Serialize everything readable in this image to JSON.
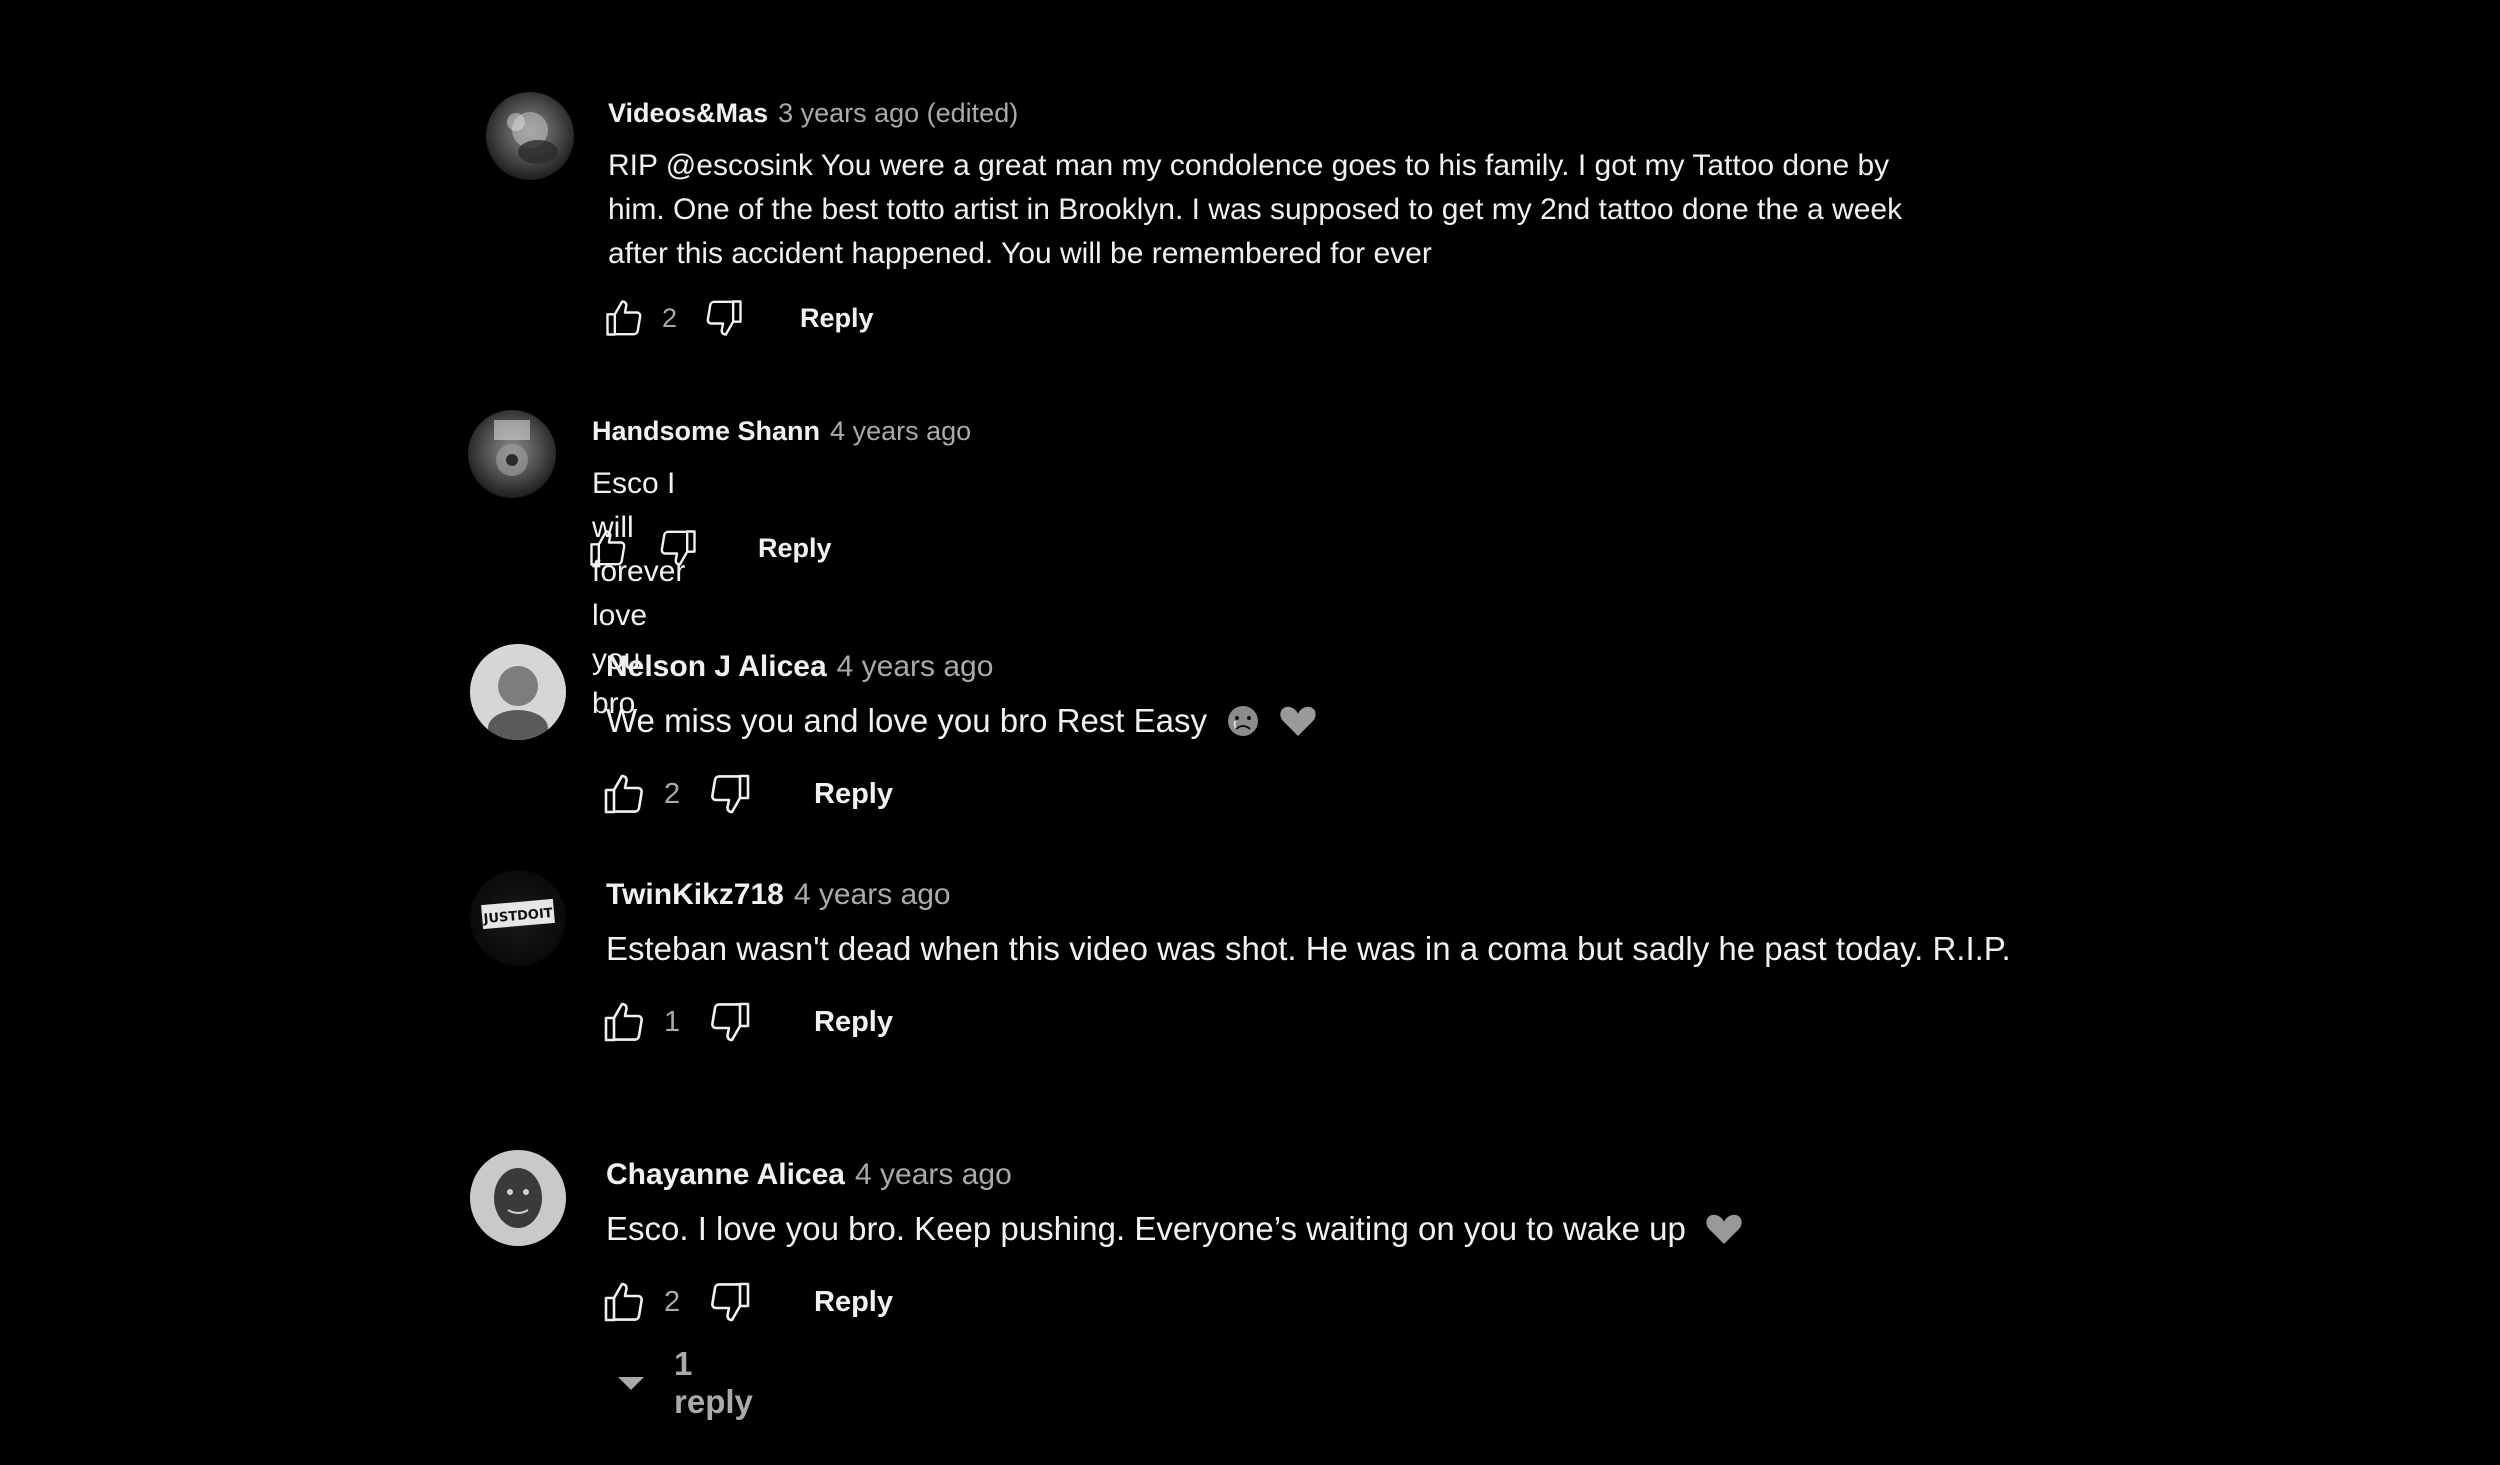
{
  "comments": [
    {
      "author": "Videos&Mas",
      "time": "3 years ago (edited)",
      "lines": [
        "RIP @escosink You were a great man my condolence goes to his family. I got my Tattoo done by",
        "him. One of the best totto artist in Brooklyn. I was supposed to get my 2nd tattoo done the a week",
        "after this accident happened. You will be remembered for ever"
      ],
      "likes": "2",
      "reply_label": "Reply",
      "icons": {
        "like": "thumbs-up-icon",
        "dislike": "thumbs-down-icon"
      }
    },
    {
      "author": "Handsome Shann",
      "time": "4 years ago",
      "lines": [
        "Esco I will forever love you bro"
      ],
      "likes": "",
      "reply_label": "Reply"
    },
    {
      "author": "Nelson J Alicea",
      "time": "4 years ago",
      "lines": [
        "We miss you and love you bro Rest Easy"
      ],
      "emojis": [
        "crying-face-emoji",
        "heart-emoji"
      ],
      "likes": "2",
      "reply_label": "Reply"
    },
    {
      "author": "TwinKikz718",
      "time": "4 years ago",
      "avatar_text": "JUSTDOIT",
      "lines": [
        "Esteban wasn't dead when this video was shot. He was in a coma but sadly he past today. R.I.P."
      ],
      "likes": "1",
      "reply_label": "Reply"
    },
    {
      "author": "Chayanne Alicea",
      "time": "4 years ago",
      "lines": [
        "Esco. I love you bro. Keep pushing. Everyone’s waiting on you to wake up"
      ],
      "emojis": [
        "heart-emoji"
      ],
      "likes": "2",
      "reply_label": "Reply",
      "replies_label": "1 reply"
    }
  ],
  "colors": {
    "background": "#000000",
    "text": "#f1f1f1",
    "secondary": "#aaaaaa"
  }
}
